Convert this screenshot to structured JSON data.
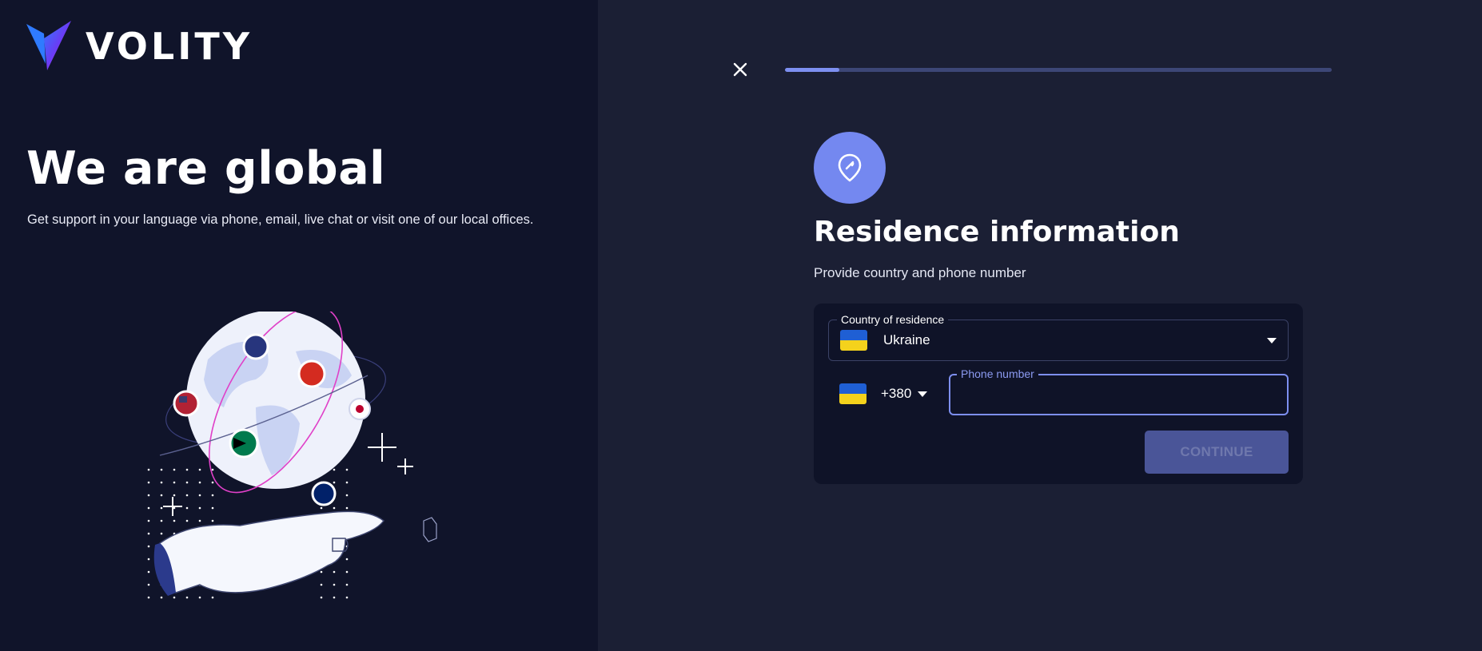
{
  "brand": {
    "name": "VOLITY"
  },
  "hero": {
    "title": "We are global",
    "subtitle": "Get support in your language via phone, email, live chat or visit one of our local offices."
  },
  "progress": {
    "fraction": 0.1
  },
  "form": {
    "icon": "location-pin-icon",
    "title": "Residence information",
    "subtitle": "Provide country and phone number",
    "country": {
      "label": "Country of residence",
      "value": "Ukraine",
      "flag": "ukraine-flag"
    },
    "phone": {
      "code": "+380",
      "label": "Phone number",
      "value": "",
      "placeholder": ""
    },
    "continue_label": "CONTINUE"
  },
  "colors": {
    "accent": "#7488f0",
    "left_bg": "#10142a",
    "right_bg": "#1b1f34",
    "card_bg": "#0f1328",
    "button_disabled": "#4a5598"
  }
}
